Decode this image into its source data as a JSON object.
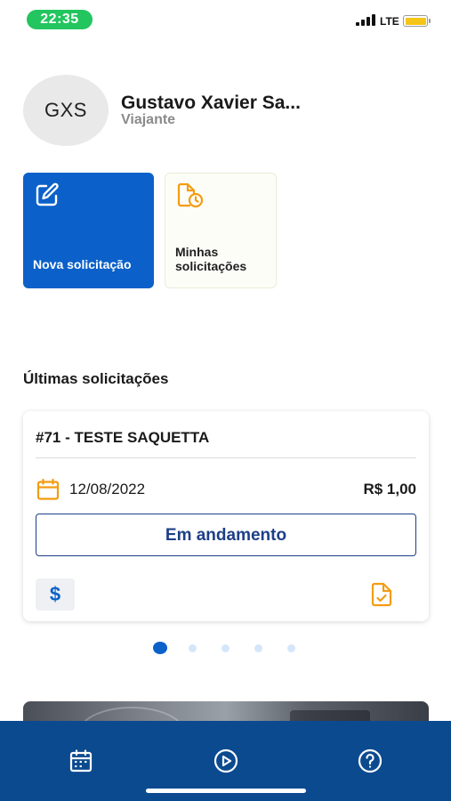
{
  "status_bar": {
    "time": "22:35",
    "network": "LTE",
    "battery_color": "#f5c518"
  },
  "profile": {
    "initials": "GXS",
    "name": "Gustavo Xavier Sa...",
    "role": "Viajante"
  },
  "actions": [
    {
      "label": "Nova solicitação",
      "icon": "edit-icon",
      "background": "#0b61c9"
    },
    {
      "label": "Minhas solicitações",
      "icon": "document-clock-icon",
      "icon_color": "#f39c12"
    }
  ],
  "recent": {
    "title": "Últimas solicitações",
    "requests": [
      {
        "title": "#71 - TESTE SAQUETTA",
        "date": "12/08/2022",
        "amount": "R$ 1,00",
        "status": "Em andamento",
        "expense_icon": "$",
        "document_icon": "document-check-icon"
      }
    ],
    "pagination": {
      "total": 5,
      "active": 1
    }
  },
  "bottom_nav": {
    "items": [
      {
        "icon": "calendar-icon"
      },
      {
        "icon": "play-circle-icon"
      },
      {
        "icon": "help-circle-icon"
      }
    ],
    "background": "#0c4a8f"
  }
}
